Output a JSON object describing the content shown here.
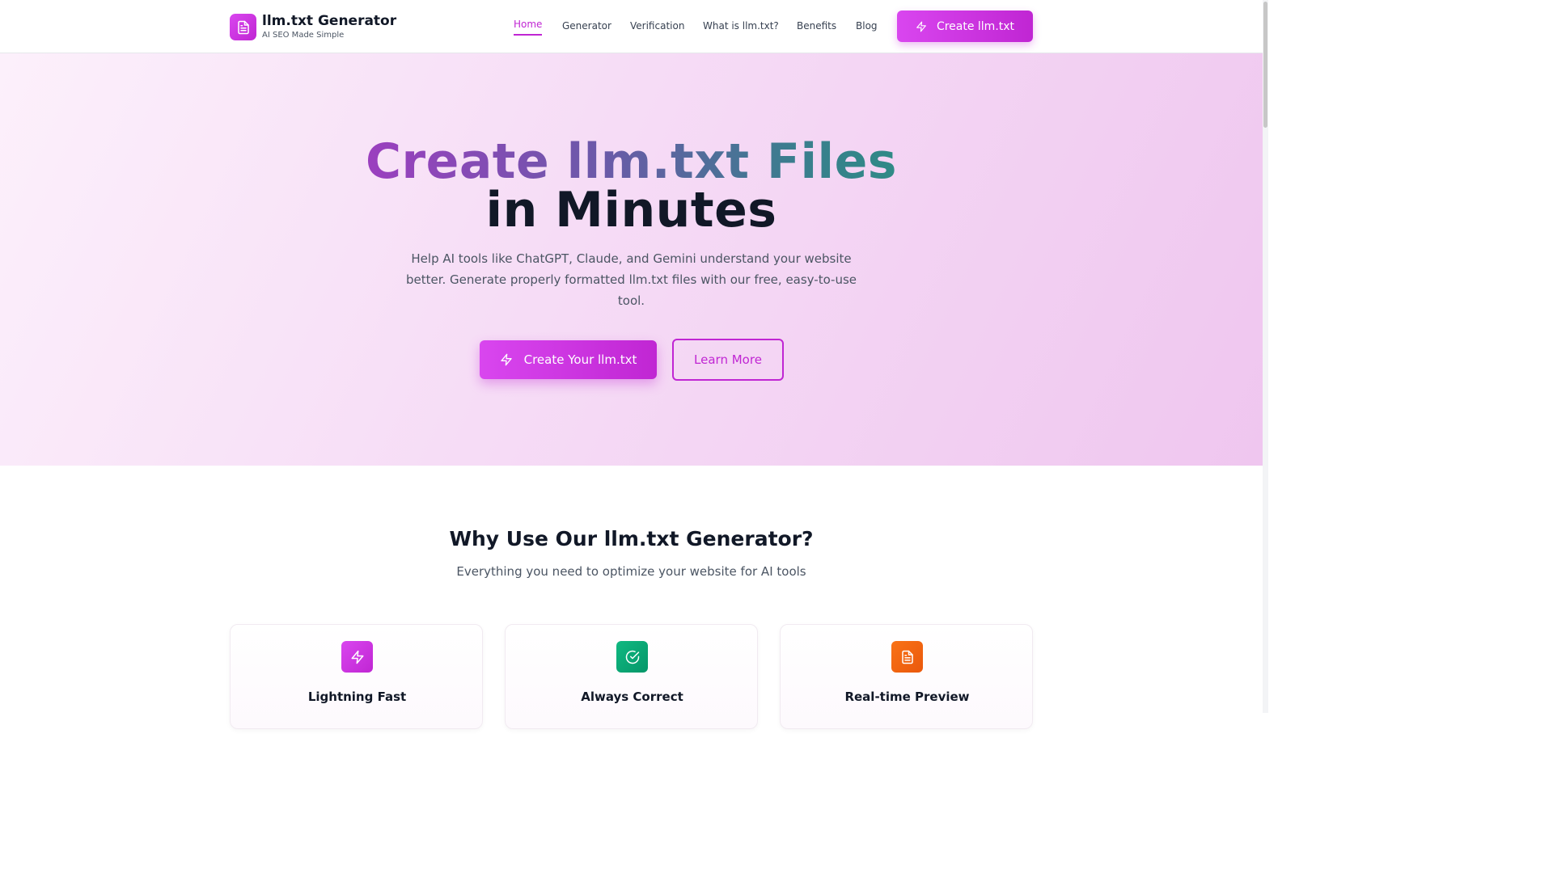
{
  "brand": {
    "title": "llm.txt Generator",
    "subtitle": "AI SEO Made Simple",
    "icon": "document-icon"
  },
  "nav": {
    "items": [
      {
        "label": "Home",
        "active": true
      },
      {
        "label": "Generator",
        "active": false
      },
      {
        "label": "Verification",
        "active": false
      },
      {
        "label": "What is llm.txt?",
        "active": false
      },
      {
        "label": "Benefits",
        "active": false
      },
      {
        "label": "Blog",
        "active": false
      }
    ],
    "cta_label": "Create llm.txt",
    "cta_icon": "lightning-icon"
  },
  "hero": {
    "title_gradient": "Create llm.txt Files",
    "title_plain": "in Minutes",
    "description": "Help AI tools like ChatGPT, Claude, and Gemini understand your website better. Generate properly formatted llm.txt files with our free, easy-to-use tool.",
    "primary_button": "Create Your llm.txt",
    "secondary_button": "Learn More"
  },
  "features": {
    "title": "Why Use Our llm.txt Generator?",
    "subtitle": "Everything you need to optimize your website for AI tools",
    "cards": [
      {
        "title": "Lightning Fast",
        "icon": "lightning-icon",
        "color": "#c026d3"
      },
      {
        "title": "Always Correct",
        "icon": "check-circle-icon",
        "color": "#059669"
      },
      {
        "title": "Real-time Preview",
        "icon": "document-icon",
        "color": "#ea580c"
      }
    ]
  },
  "colors": {
    "accent": "#c026d3",
    "accent_light": "#d946ef",
    "text": "#111827",
    "muted": "#4b5563"
  }
}
